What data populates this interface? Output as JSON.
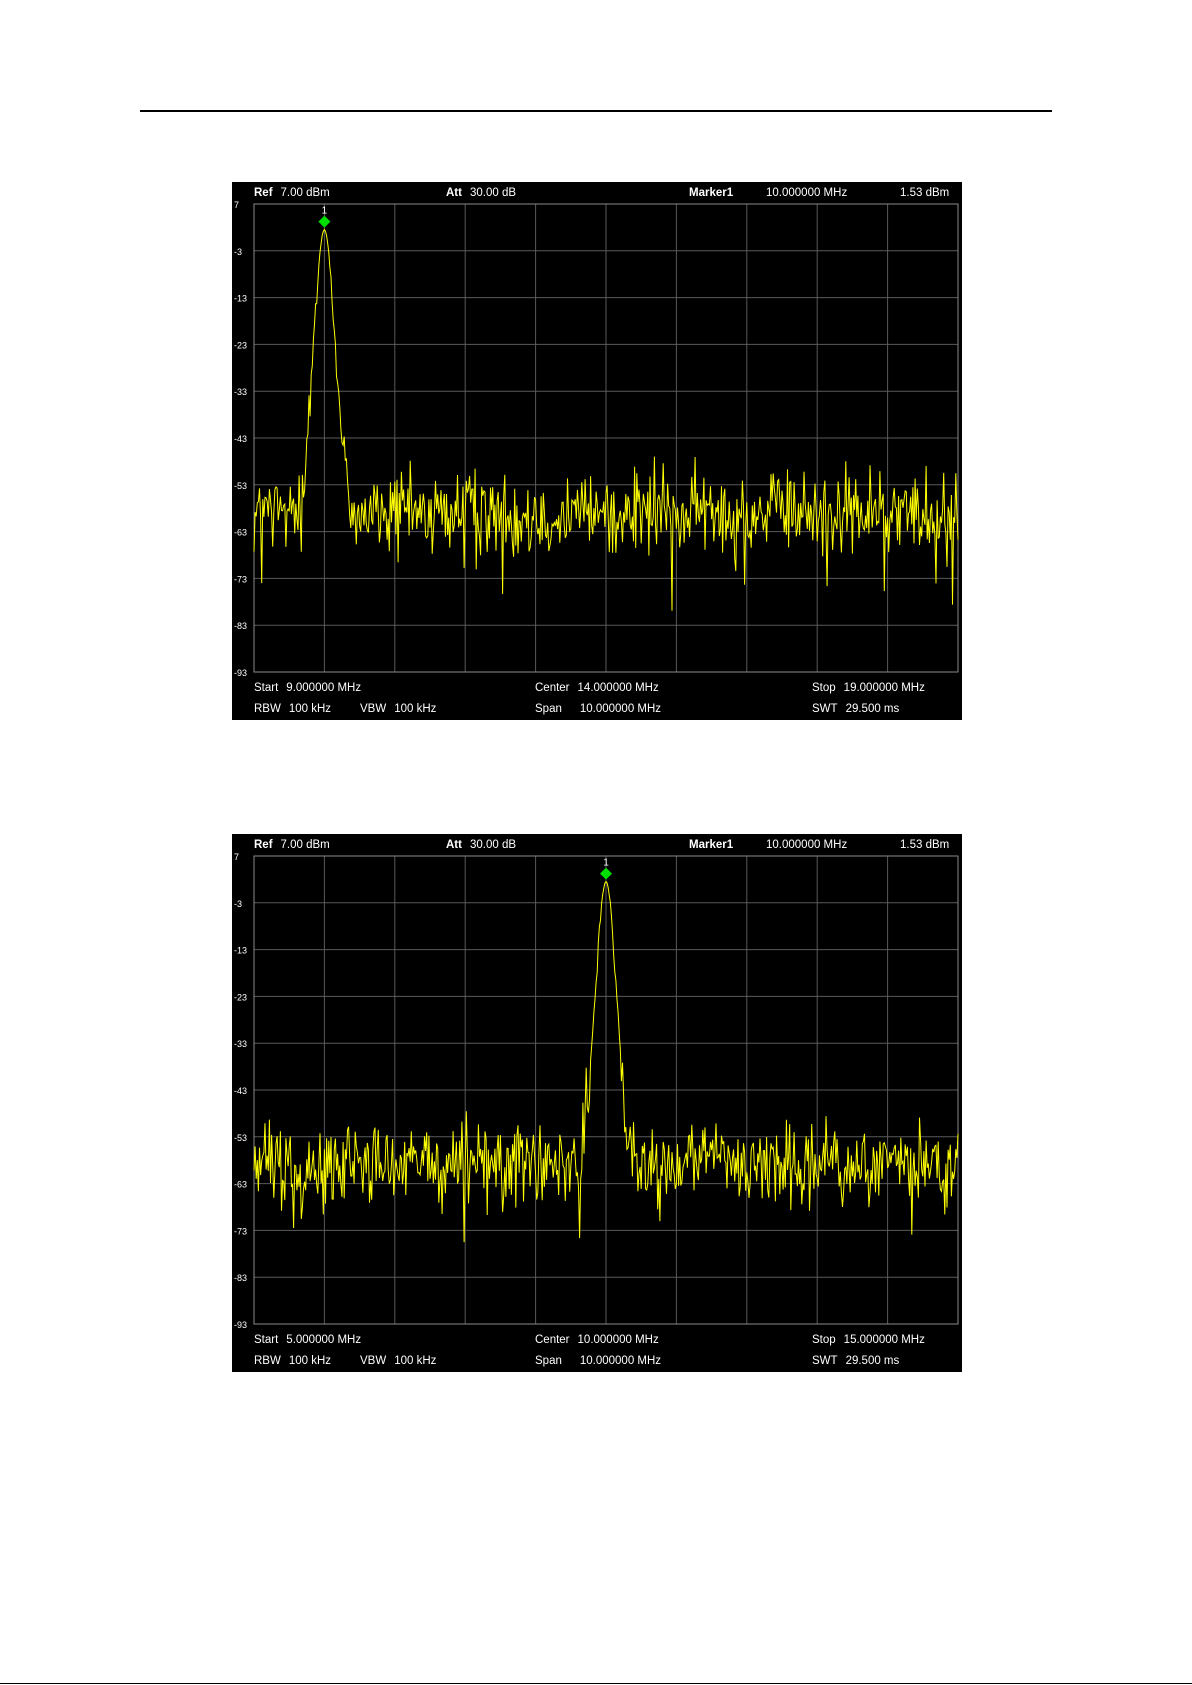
{
  "chart_data": [
    {
      "type": "line",
      "header": {
        "ref_label": "Ref",
        "ref_value": "7.00 dBm",
        "att_label": "Att",
        "att_value": "30.00 dB",
        "marker_label": "Marker1",
        "marker_freq": "10.000000 MHz",
        "marker_level": "1.53 dBm"
      },
      "footer": {
        "start_label": "Start",
        "start_value": "9.000000 MHz",
        "center_label": "Center",
        "center_value": "14.000000 MHz",
        "stop_label": "Stop",
        "stop_value": "19.000000 MHz",
        "rbw_label": "RBW",
        "rbw_value": "100 kHz",
        "vbw_label": "VBW",
        "vbw_value": "100 kHz",
        "span_label": "Span",
        "span_value": "10.000000 MHz",
        "swt_label": "SWT",
        "swt_value": "29.500 ms"
      },
      "y_ticks": [
        "7",
        "-3",
        "-13",
        "-23",
        "-33",
        "-43",
        "-53",
        "-63",
        "-73",
        "-83",
        "-93"
      ],
      "ylim": [
        -93,
        7
      ],
      "xlim_mhz": [
        9,
        19
      ],
      "grid": true,
      "marker": {
        "label": "1",
        "x_mhz": 10.0,
        "level_dbm": 1.53
      },
      "signal": {
        "peak_freq_mhz": 10.0,
        "peak_level_dbm": 1.53,
        "noise_floor_dbm": -59
      },
      "colors": {
        "trace": "#ffff00",
        "marker": "#00e000",
        "grid": "#5a5a5a",
        "background": "#000000"
      }
    },
    {
      "type": "line",
      "header": {
        "ref_label": "Ref",
        "ref_value": "7.00 dBm",
        "att_label": "Att",
        "att_value": "30.00 dB",
        "marker_label": "Marker1",
        "marker_freq": "10.000000 MHz",
        "marker_level": "1.53 dBm"
      },
      "footer": {
        "start_label": "Start",
        "start_value": "5.000000 MHz",
        "center_label": "Center",
        "center_value": "10.000000 MHz",
        "stop_label": "Stop",
        "stop_value": "15.000000 MHz",
        "rbw_label": "RBW",
        "rbw_value": "100 kHz",
        "vbw_label": "VBW",
        "vbw_value": "100 kHz",
        "span_label": "Span",
        "span_value": "10.000000 MHz",
        "swt_label": "SWT",
        "swt_value": "29.500 ms"
      },
      "y_ticks": [
        "7",
        "-3",
        "-13",
        "-23",
        "-33",
        "-43",
        "-53",
        "-63",
        "-73",
        "-83",
        "-93"
      ],
      "ylim": [
        -93,
        7
      ],
      "xlim_mhz": [
        5,
        15
      ],
      "grid": true,
      "marker": {
        "label": "1",
        "x_mhz": 10.0,
        "level_dbm": 1.53
      },
      "signal": {
        "peak_freq_mhz": 10.0,
        "peak_level_dbm": 1.53,
        "noise_floor_dbm": -59
      },
      "colors": {
        "trace": "#ffff00",
        "marker": "#00e000",
        "grid": "#5a5a5a",
        "background": "#000000"
      }
    }
  ]
}
